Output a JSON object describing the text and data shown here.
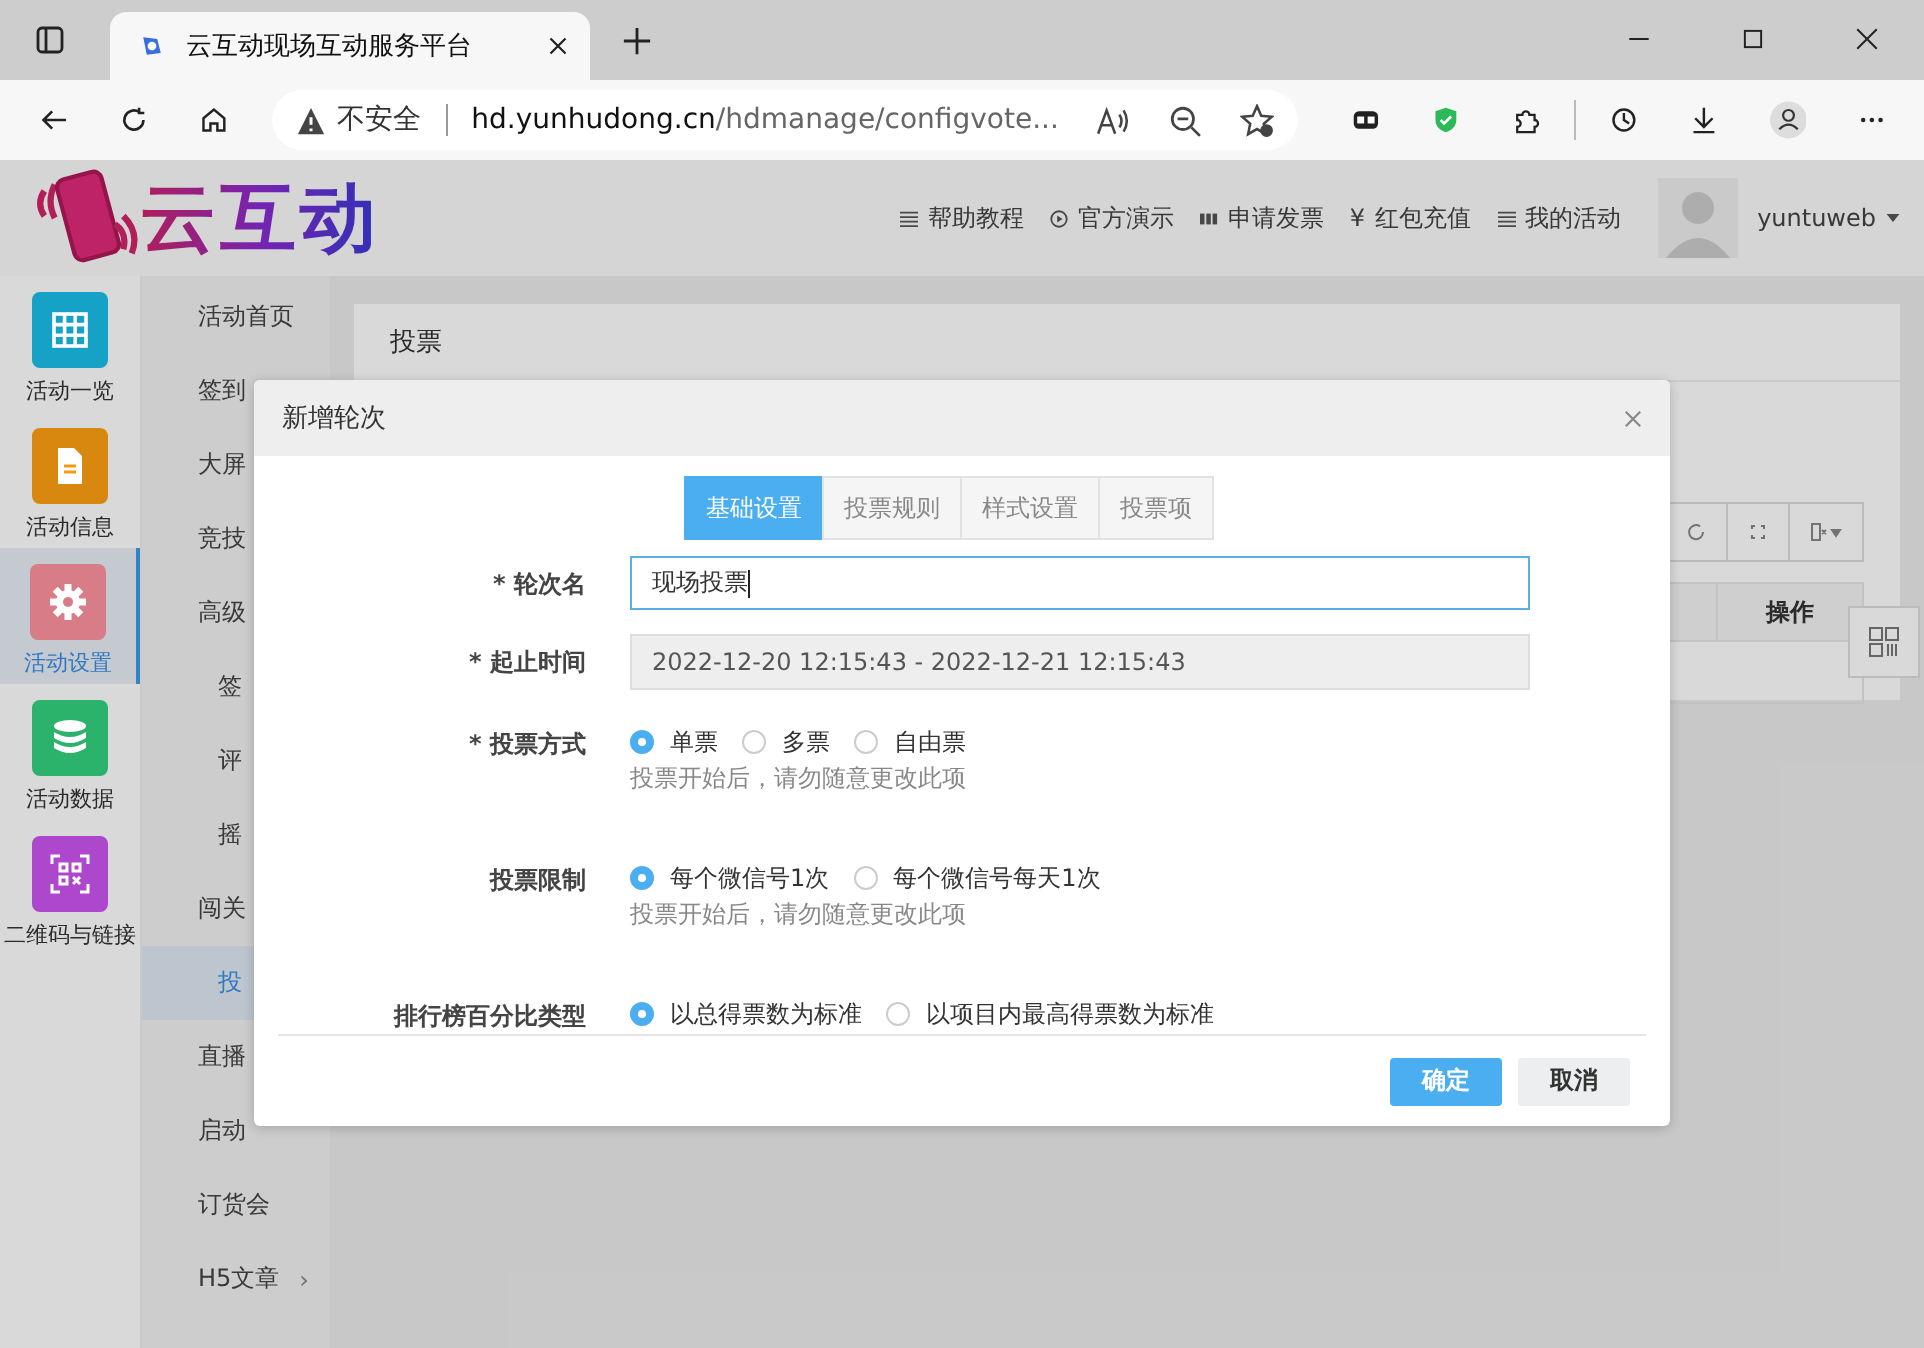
{
  "browser": {
    "tab_title": "云互动现场互动服务平台",
    "url_warning": "不安全",
    "url_host": "hd.yunhudong.cn",
    "url_path": "/hdmanage/configvote..."
  },
  "header": {
    "logo": "云互动",
    "nav": [
      {
        "kind": "list",
        "label": "帮助教程"
      },
      {
        "kind": "play",
        "label": "官方演示"
      },
      {
        "kind": "bars",
        "label": "申请发票"
      },
      {
        "kind": "glyph",
        "glyph": "¥",
        "label": "红包充值"
      },
      {
        "kind": "list",
        "label": "我的活动"
      }
    ],
    "username": "yuntuweb"
  },
  "sidebar": {
    "items": [
      {
        "kind": "grid",
        "label": "活动一览",
        "color": "#16a2c6",
        "selected": false
      },
      {
        "kind": "doc",
        "label": "活动信息",
        "color": "#d9880f",
        "selected": false
      },
      {
        "kind": "gear",
        "label": "活动设置",
        "color": "#d87c88",
        "selected": true
      },
      {
        "kind": "db",
        "label": "活动数据",
        "color": "#2bb26b",
        "selected": false
      },
      {
        "kind": "qr",
        "label": "二维码与链接",
        "color": "#ad47cc",
        "selected": false
      }
    ]
  },
  "subnav": {
    "items": [
      {
        "label": "活动首页",
        "selected": false
      },
      {
        "label": "签到",
        "selected": false
      },
      {
        "label": "大屏",
        "selected": false
      },
      {
        "label": "竞技",
        "selected": false
      },
      {
        "label": "高级",
        "selected": false,
        "children": [
          {
            "label": "签",
            "selected": false
          },
          {
            "label": "评",
            "selected": false
          },
          {
            "label": "摇",
            "selected": false
          }
        ]
      },
      {
        "label": "闯关",
        "selected": false,
        "children": [
          {
            "label": "投",
            "selected": true
          }
        ]
      },
      {
        "label": "直播",
        "selected": false
      },
      {
        "label": "启动",
        "selected": false
      },
      {
        "label": "订货会",
        "selected": false
      },
      {
        "label": "H5文章",
        "selected": false,
        "arrow": "›"
      }
    ]
  },
  "page": {
    "title": "投票",
    "table": {
      "columns": [
        "操作"
      ]
    }
  },
  "dialog": {
    "title": "新增轮次",
    "tabs": [
      {
        "label": "基础设置",
        "selected": true
      },
      {
        "label": "投票规则",
        "selected": false
      },
      {
        "label": "样式设置",
        "selected": false
      },
      {
        "label": "投票项",
        "selected": false
      }
    ],
    "fields": [
      {
        "kind": "text",
        "label": "* 轮次名",
        "value": "现场投票"
      },
      {
        "kind": "disabled",
        "label": "* 起止时间",
        "value": "2022-12-20 12:15:43 - 2022-12-21 12:15:43"
      },
      {
        "kind": "radio",
        "label": "* 投票方式",
        "options": [
          {
            "label": "单票",
            "selected": true
          },
          {
            "label": "多票",
            "selected": false
          },
          {
            "label": "自由票",
            "selected": false
          }
        ],
        "hint": "投票开始后，请勿随意更改此项"
      },
      {
        "kind": "radio",
        "label": "投票限制",
        "options": [
          {
            "label": "每个微信号1次",
            "selected": true
          },
          {
            "label": "每个微信号每天1次",
            "selected": false
          }
        ],
        "hint": "投票开始后，请勿随意更改此项"
      },
      {
        "kind": "radio",
        "label": "排行榜百分比类型",
        "options": [
          {
            "label": "以总得票数为标准",
            "selected": true
          },
          {
            "label": "以项目内最高得票数为标准",
            "selected": false
          }
        ]
      }
    ],
    "buttons": [
      {
        "kind": "primary",
        "label": "确定"
      },
      {
        "kind": "default",
        "label": "取消"
      }
    ]
  }
}
